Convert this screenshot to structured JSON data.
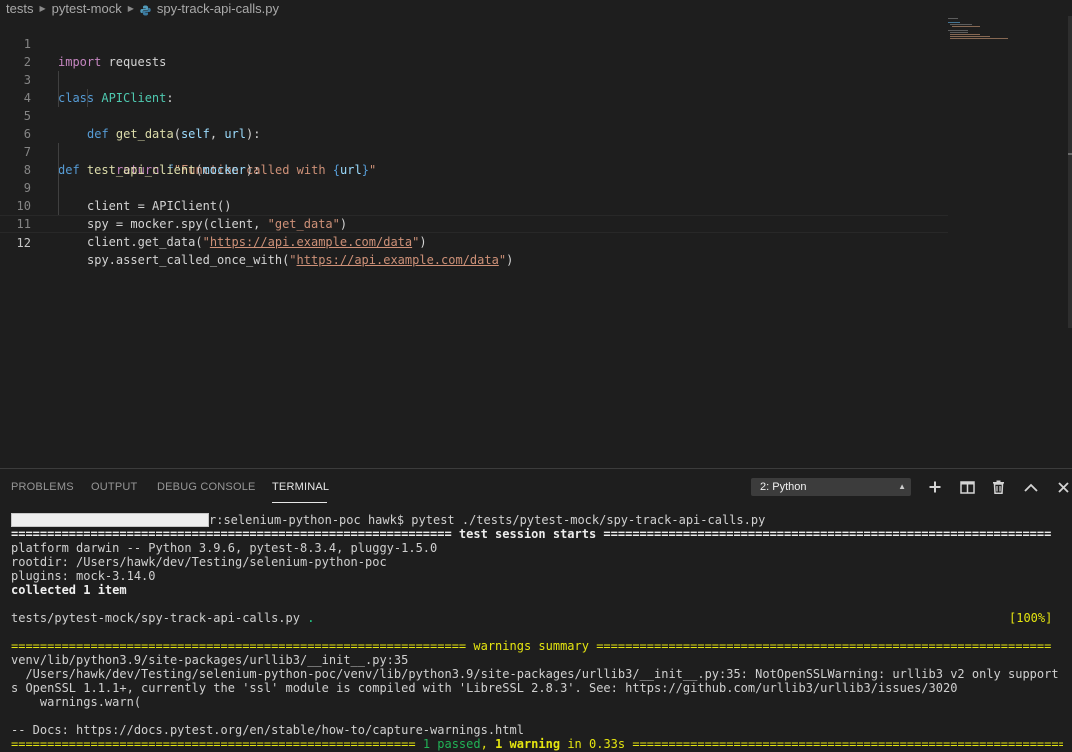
{
  "breadcrumb": {
    "items": [
      "tests",
      "pytest-mock"
    ],
    "file": "spy-track-api-calls.py"
  },
  "editor": {
    "line_numbers": [
      "1",
      "2",
      "3",
      "4",
      "5",
      "6",
      "7",
      "8",
      "9",
      "10",
      "11",
      "12"
    ],
    "current_line": "12",
    "code": {
      "l1_kw": "import",
      "l1_rest": " requests",
      "l3_kw": "class",
      "l3_cls": "APIClient",
      "l3_rest": ":",
      "l4_kw": "def",
      "l4_fn": "get_data",
      "l4_p1": "self",
      "l4_p2": "url",
      "l5_kw": "return",
      "l5_f": "f",
      "l5_str": "\"Function called with ",
      "l5_var": "url",
      "l5_end": "\"",
      "l7_kw": "def",
      "l7_fn": "test_api_client",
      "l7_p": "mocker",
      "l8": "client = APIClient()",
      "l9_pre": "spy = mocker.spy(client, ",
      "l9_str": "\"get_data\"",
      "l9_post": ")",
      "l10_pre": "client.get_data(",
      "l10_url": "https://api.example.com/data",
      "l10_post": ")",
      "l11_pre": "spy.assert_called_once_with(",
      "l11_url": "https://api.example.com/data",
      "l11_post": ")",
      "quote": "\""
    }
  },
  "panel": {
    "tabs": [
      "PROBLEMS",
      "OUTPUT",
      "DEBUG CONSOLE",
      "TERMINAL"
    ],
    "active_tab": "TERMINAL",
    "terminal_selector": "2: Python",
    "actions": [
      "plus-icon",
      "split-icon",
      "trash-icon",
      "chevron-up-icon",
      "close-icon"
    ]
  },
  "terminal": {
    "prompt_suffix": "r:selenium-python-poc hawk$ pytest ./tests/pytest-mock/spy-track-api-calls.py",
    "session_start": "============================================================= test session starts ==============================================================",
    "platform": "platform darwin -- Python 3.9.6, pytest-8.3.4, pluggy-1.5.0",
    "rootdir": "rootdir: /Users/hawk/dev/Testing/selenium-python-poc",
    "plugins": "plugins: mock-3.14.0",
    "collected": "collected 1 item",
    "test_file": "tests/pytest-mock/spy-track-api-calls.py",
    "test_dot": ".",
    "progress": "[100%]",
    "warnings_left": "=============================================================== ",
    "warnings_title": "warnings summary",
    "warnings_right": " ===============================================================",
    "warn_loc": "venv/lib/python3.9/site-packages/urllib3/__init__.py:35",
    "warn_msg1": "  /Users/hawk/dev/Testing/selenium-python-poc/venv/lib/python3.9/site-packages/urllib3/__init__.py:35: NotOpenSSLWarning: urllib3 v2 only support",
    "warn_msg2": "s OpenSSL 1.1.1+, currently the 'ssl' module is compiled with 'LibreSSL 2.8.3'. See: https://github.com/urllib3/urllib3/issues/3020",
    "warn_msg3": "    warnings.warn(",
    "docs": "-- Docs: https://docs.pytest.org/en/stable/how-to/capture-warnings.html",
    "summary_left": "======================================================== ",
    "summary_passed": "1 passed",
    "summary_comma": ", ",
    "summary_warning": "1 warning",
    "summary_time": " in 0.33s",
    "summary_right": " ================================================================"
  },
  "colors": {
    "background": "#1e1e1e",
    "keyword": "#c586c0",
    "declaration": "#569cd6",
    "class": "#4ec9b0",
    "function": "#dcdcaa",
    "parameter": "#9cdcfe",
    "string": "#ce9178",
    "passed": "#23d18b",
    "warning": "#e5e510"
  }
}
